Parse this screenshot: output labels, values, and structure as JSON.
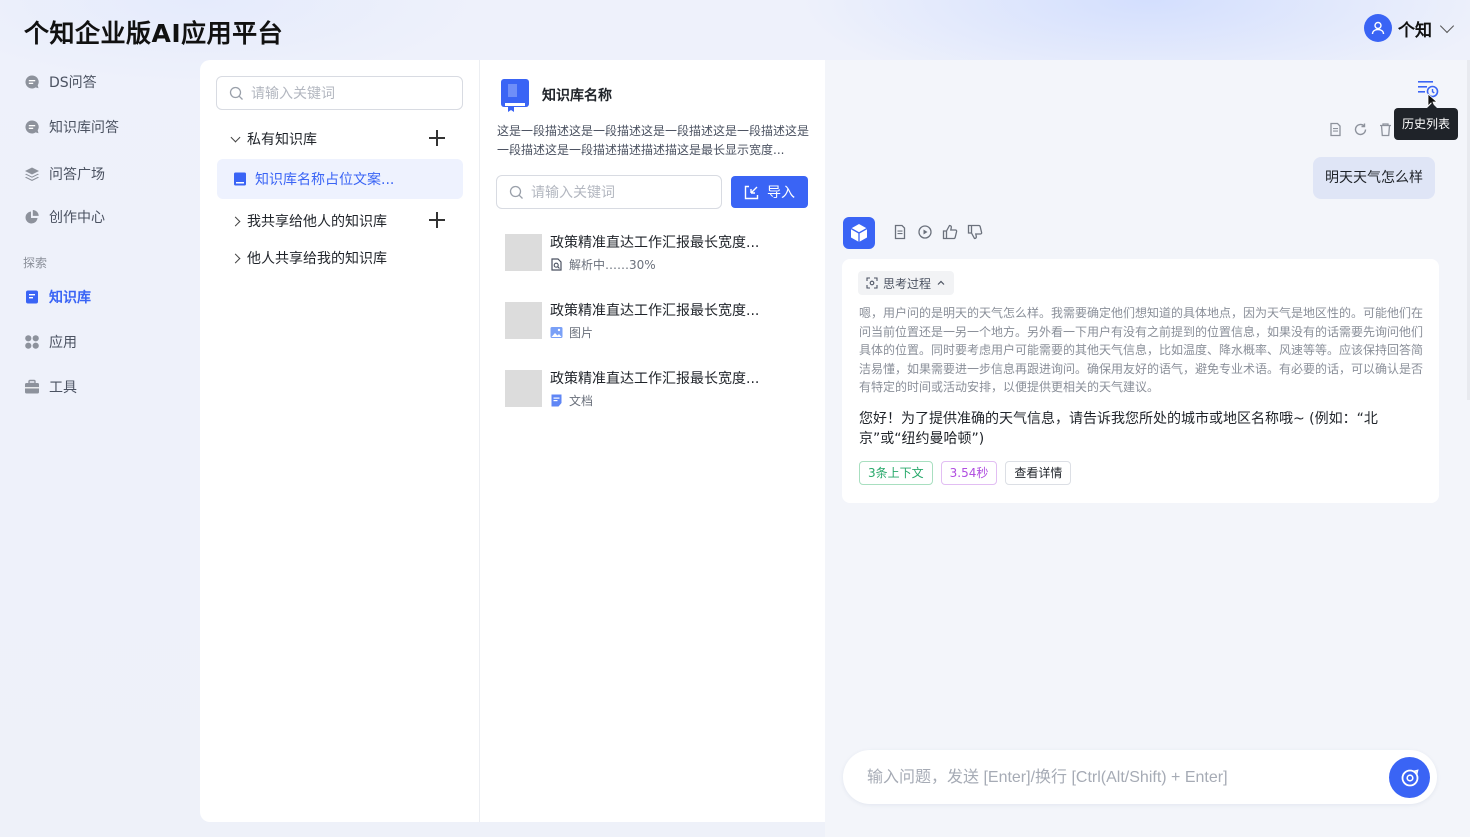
{
  "app": {
    "title": "个知企业版AI应用平台"
  },
  "user": {
    "name": "个知"
  },
  "nav": {
    "items": [
      {
        "label": "DS问答",
        "icon": "chat-bubble-icon"
      },
      {
        "label": "知识库问答",
        "icon": "chat-bubble-icon"
      },
      {
        "label": "问答广场",
        "icon": "layers-icon"
      },
      {
        "label": "创作中心",
        "icon": "pie-icon"
      }
    ],
    "section_label": "探索",
    "explore": [
      {
        "label": "知识库",
        "icon": "book-icon",
        "active": true
      },
      {
        "label": "应用",
        "icon": "apps-grid-icon"
      },
      {
        "label": "工具",
        "icon": "toolbox-icon"
      }
    ]
  },
  "kb_tree": {
    "search_placeholder": "请输入关键词",
    "private_label": "私有知识库",
    "selected_kb": "知识库名称占位文案...",
    "shared_by_me": "我共享给他人的知识库",
    "shared_to_me": "他人共享给我的知识库"
  },
  "kb_detail": {
    "name": "知识库名称",
    "description": "这是一段描述这是一段描述这是一段描述这是一段描述这是一段描述这是一段描述描述描述描这是最长显示宽度...",
    "search_placeholder": "请输入关键词",
    "import_label": "导入",
    "docs": [
      {
        "title": "政策精准直达工作汇报最长宽度...",
        "meta": "解析中……30%",
        "icon": "doc-parsing-icon"
      },
      {
        "title": "政策精准直达工作汇报最长宽度...",
        "meta": "图片",
        "icon": "image-icon"
      },
      {
        "title": "政策精准直达工作汇报最长宽度...",
        "meta": "文档",
        "icon": "document-icon"
      }
    ]
  },
  "chat": {
    "history_tooltip": "历史列表",
    "user_message": "明天天气怎么样",
    "think_label": "思考过程",
    "think_text": "嗯，用户问的是明天的天气怎么样。我需要确定他们想知道的具体地点，因为天气是地区性的。可能他们在问当前位置还是一另一个地方。另外看一下用户有没有之前提到的位置信息，如果没有的话需要先询问他们具体的位置。同时要考虑用户可能需要的其他天气信息，比如温度、降水概率、风速等等。应该保持回答简洁易懂，如果需要进一步信息再跟进询问。确保用友好的语气，避免专业术语。有必要的话，可以确认是否有特定的时间或活动安排，以便提供更相关的天气建议。",
    "answer_text": "您好！为了提供准确的天气信息，请告诉我您所处的城市或地区名称哦~ (例如：“北京”或“纽约曼哈顿”)",
    "context_chip": "3条上下文",
    "time_chip": "3.54秒",
    "detail_chip": "查看详情",
    "input_placeholder": "输入问题，发送 [Enter]/换行 [Ctrl(Alt/Shift) + Enter]"
  },
  "colors": {
    "accent": "#3a64f5",
    "background": "#eef1fb"
  }
}
